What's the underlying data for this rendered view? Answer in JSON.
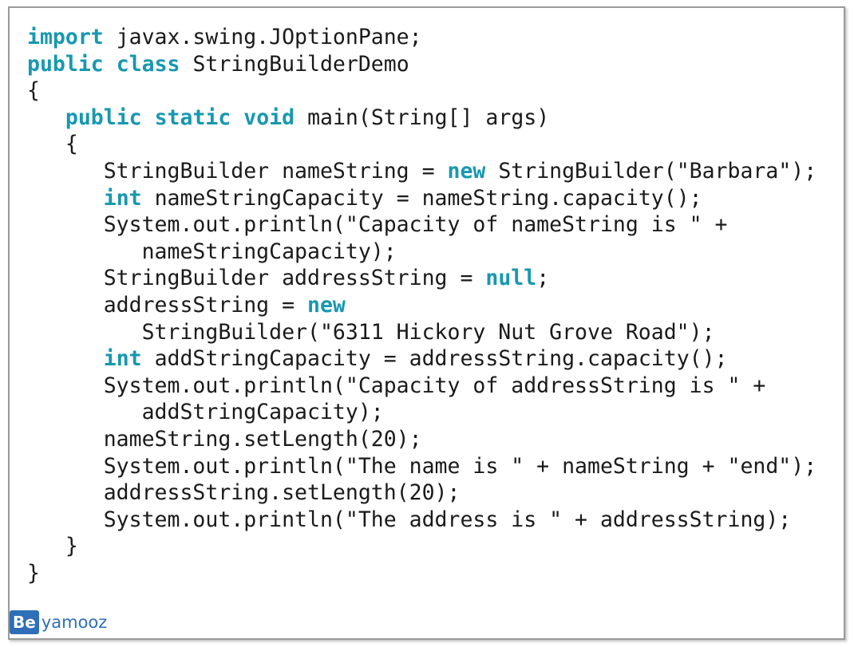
{
  "code_lines": [
    [
      {
        "t": "import",
        "k": true
      },
      {
        "t": " javax.swing.JOptionPane;"
      }
    ],
    [
      {
        "t": "public",
        "k": true
      },
      {
        "t": " "
      },
      {
        "t": "class",
        "k": true
      },
      {
        "t": " StringBuilderDemo"
      }
    ],
    [
      {
        "t": "{"
      }
    ],
    [
      {
        "t": "   "
      },
      {
        "t": "public",
        "k": true
      },
      {
        "t": " "
      },
      {
        "t": "static",
        "k": true
      },
      {
        "t": " "
      },
      {
        "t": "void",
        "k": true
      },
      {
        "t": " main(String[] args)"
      }
    ],
    [
      {
        "t": "   {"
      }
    ],
    [
      {
        "t": "      StringBuilder nameString = "
      },
      {
        "t": "new",
        "k": true
      },
      {
        "t": " StringBuilder(\"Barbara\");"
      }
    ],
    [
      {
        "t": "      "
      },
      {
        "t": "int",
        "k": true
      },
      {
        "t": " nameStringCapacity = nameString.capacity();"
      }
    ],
    [
      {
        "t": "      System.out.println(\"Capacity of nameString is \" +"
      }
    ],
    [
      {
        "t": "         nameStringCapacity);"
      }
    ],
    [
      {
        "t": "      StringBuilder addressString = "
      },
      {
        "t": "null",
        "k": true
      },
      {
        "t": ";"
      }
    ],
    [
      {
        "t": "      addressString = "
      },
      {
        "t": "new",
        "k": true
      }
    ],
    [
      {
        "t": "         StringBuilder(\"6311 Hickory Nut Grove Road\");"
      }
    ],
    [
      {
        "t": "      "
      },
      {
        "t": "int",
        "k": true
      },
      {
        "t": " addStringCapacity = addressString.capacity();"
      }
    ],
    [
      {
        "t": "      System.out.println(\"Capacity of addressString is \" +"
      }
    ],
    [
      {
        "t": "         addStringCapacity);"
      }
    ],
    [
      {
        "t": "      nameString.setLength(20);"
      }
    ],
    [
      {
        "t": "      System.out.println(\"The name is \" + nameString + \"end\");"
      }
    ],
    [
      {
        "t": "      addressString.setLength(20);"
      }
    ],
    [
      {
        "t": "      System.out.println(\"The address is \" + addressString);"
      }
    ],
    [
      {
        "t": "   }"
      }
    ],
    [
      {
        "t": "}"
      }
    ]
  ],
  "colors": {
    "keyword": "#1798b0",
    "text": "#1a1a1a",
    "logo": "#2e6fb7"
  },
  "logo": {
    "box_text": "Be",
    "text": "yamooz"
  }
}
